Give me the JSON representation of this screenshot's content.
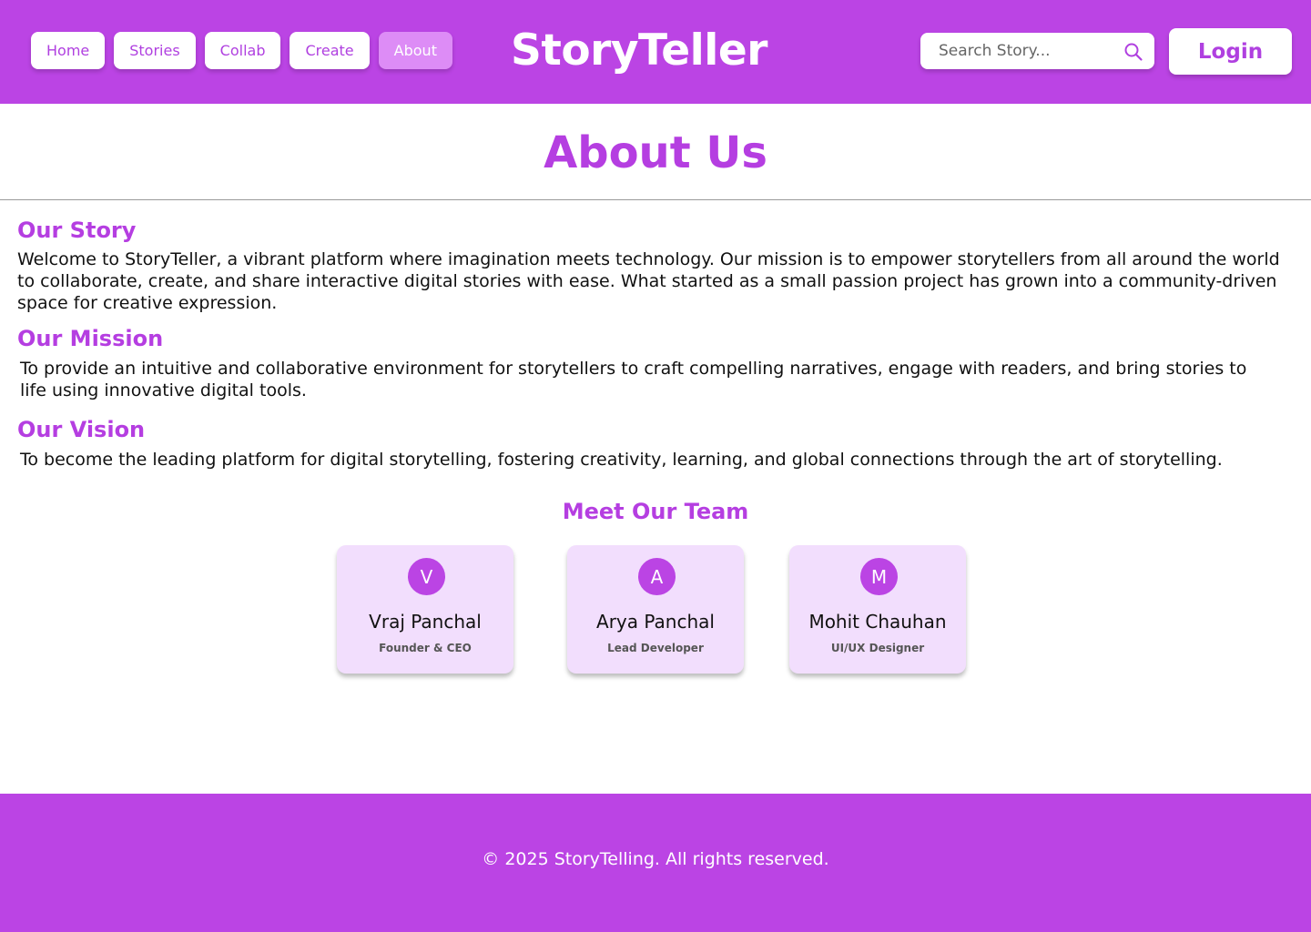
{
  "header": {
    "nav": [
      {
        "label": "Home",
        "active": false
      },
      {
        "label": "Stories",
        "active": false
      },
      {
        "label": "Collab",
        "active": false
      },
      {
        "label": "Create",
        "active": false
      },
      {
        "label": "About",
        "active": true
      }
    ],
    "brand": "StoryTeller",
    "search_placeholder": "Search Story...",
    "search_icon": "search-icon",
    "login_label": "Login"
  },
  "page": {
    "title": "About Us"
  },
  "sections": {
    "story": {
      "heading": "Our Story",
      "text": "Welcome to StoryTeller, a vibrant platform where imagination meets technology. Our mission is to empower storytellers from all around the world to collaborate, create, and share interactive digital stories with ease. What started as a small passion project has grown into a community-driven space for creative expression."
    },
    "mission": {
      "heading": "Our Mission",
      "text": "To provide an intuitive and collaborative environment for storytellers to craft compelling narratives, engage with readers, and bring stories to life using innovative digital tools."
    },
    "vision": {
      "heading": "Our Vision",
      "text": "To become the leading platform for digital storytelling, fostering creativity, learning, and global connections through the art of storytelling."
    }
  },
  "team": {
    "heading": "Meet Our Team",
    "members": [
      {
        "initial": "V",
        "name": "Vraj Panchal",
        "role": "Founder & CEO"
      },
      {
        "initial": "A",
        "name": "Arya Panchal",
        "role": "Lead Developer"
      },
      {
        "initial": "M",
        "name": "Mohit Chauhan",
        "role": "UI/UX Designer"
      }
    ]
  },
  "footer": {
    "text": "© 2025 StoryTelling. All rights reserved."
  },
  "colors": {
    "brand": "#bb44e4",
    "accent_text": "#b53ee1",
    "card_bg": "#f2defd",
    "active_nav": "#dd8cf6"
  }
}
